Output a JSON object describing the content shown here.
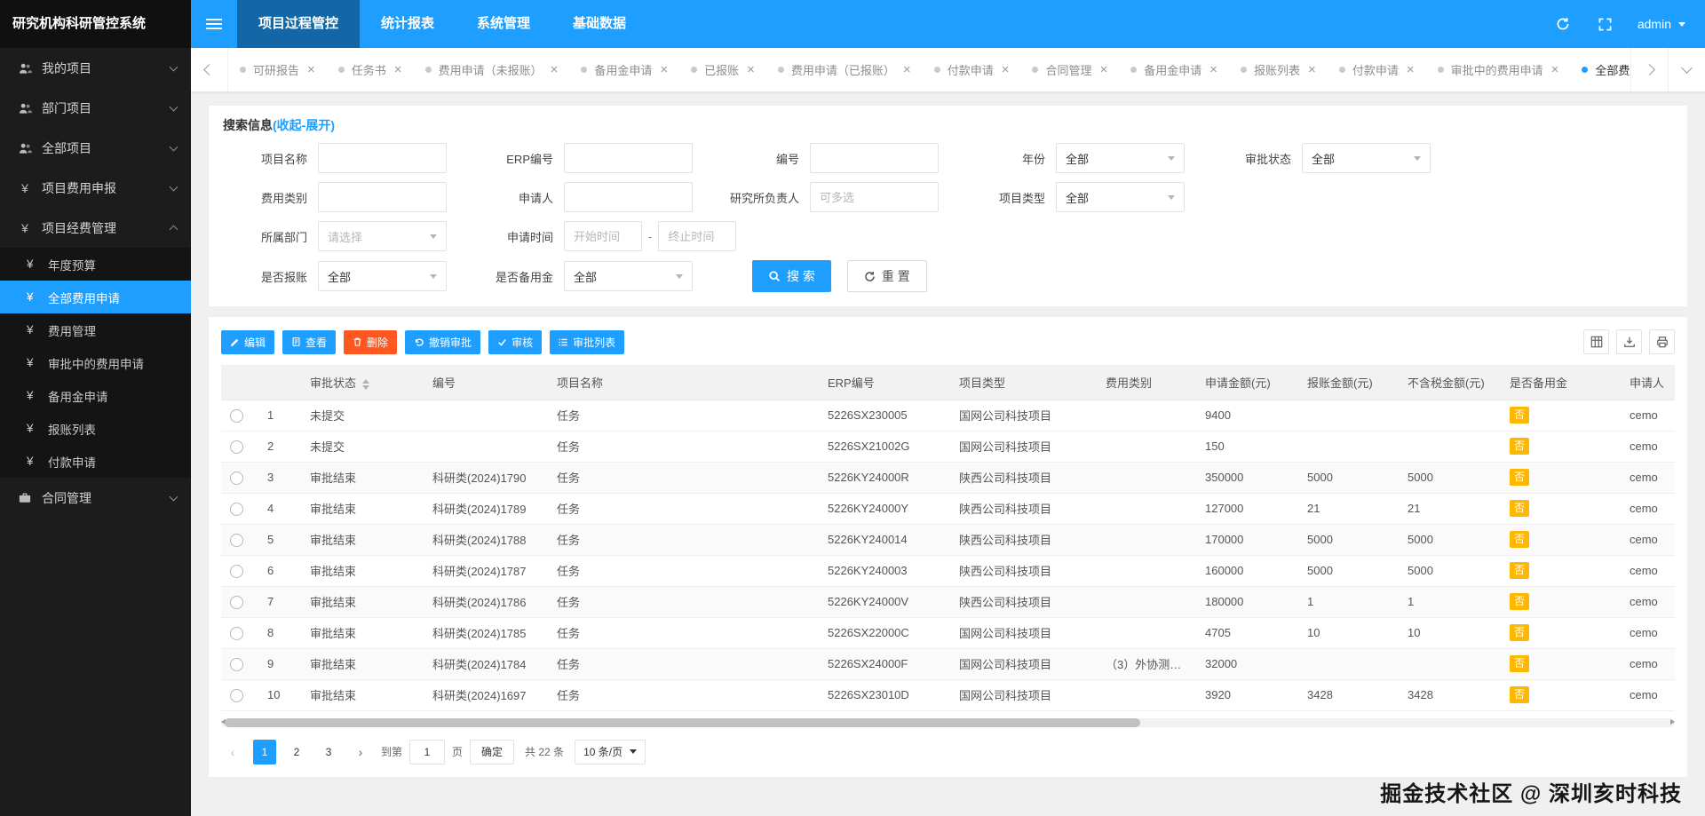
{
  "app": {
    "title": "研究机构科研管控系统",
    "user": "admin",
    "watermark": "掘金技术社区 @ 深圳亥时科技"
  },
  "icons": {
    "close": "×",
    "yen": "¥"
  },
  "topnav": {
    "items": [
      "项目过程管控",
      "统计报表",
      "系统管理",
      "基础数据"
    ]
  },
  "sidebar": {
    "items": [
      "我的项目",
      "部门项目",
      "全部项目",
      "项目费用申报",
      "项目经费管理",
      "合同管理"
    ],
    "submenu": [
      "年度预算",
      "全部费用申请",
      "费用管理",
      "审批中的费用申请",
      "备用金申请",
      "报账列表",
      "付款申请"
    ]
  },
  "tabstrip": {
    "items": [
      "可研报告",
      "任务书",
      "费用申请（未报账）",
      "备用金申请",
      "已报账",
      "费用申请（已报账）",
      "付款申请",
      "合同管理",
      "备用金申请",
      "报账列表",
      "付款申请",
      "审批中的费用申请",
      "全部费用"
    ]
  },
  "search": {
    "title": "搜索信息",
    "toggle": "(收起-展开)",
    "fields": {
      "project_name": {
        "label": "项目名称"
      },
      "erp_no": {
        "label": "ERP编号"
      },
      "no": {
        "label": "编号"
      },
      "year": {
        "label": "年份",
        "value": "全部"
      },
      "approval_status": {
        "label": "审批状态",
        "value": "全部"
      },
      "expense_category": {
        "label": "费用类别"
      },
      "applicant": {
        "label": "申请人"
      },
      "institute_leader": {
        "label": "研究所负责人",
        "placeholder": "可多选"
      },
      "project_type": {
        "label": "项目类型",
        "value": "全部"
      },
      "department": {
        "label": "所属部门",
        "placeholder": "请选择"
      },
      "apply_time": {
        "label": "申请时间",
        "start_placeholder": "开始时间",
        "separator": "-",
        "end_placeholder": "终止时间"
      },
      "is_reimbursed": {
        "label": "是否报账",
        "value": "全部"
      },
      "is_reserve": {
        "label": "是否备用金",
        "value": "全部"
      }
    },
    "buttons": {
      "search": "搜 索",
      "reset": "重 置"
    }
  },
  "toolbar": {
    "buttons": {
      "edit": "编辑",
      "view": "查看",
      "delete": "删除",
      "revoke": "撤销审批",
      "audit": "审核",
      "audit_list": "审批列表"
    }
  },
  "table": {
    "columns": [
      "审批状态",
      "编号",
      "项目名称",
      "ERP编号",
      "项目类型",
      "费用类别",
      "申请金额(元)",
      "报账金额(元)",
      "不含税金额(元)",
      "是否备用金",
      "申请人"
    ],
    "rows": [
      {
        "index": "1",
        "status": "未提交",
        "no": "",
        "name": "任务",
        "erp": "5226SX230005",
        "type": "国网公司科技项目",
        "category": "",
        "amount": "9400",
        "reimbursed": "",
        "tax_free": "",
        "reserve": "否",
        "applicant": "cemo"
      },
      {
        "index": "2",
        "status": "未提交",
        "no": "",
        "name": "任务",
        "erp": "5226SX21002G",
        "type": "国网公司科技项目",
        "category": "",
        "amount": "150",
        "reimbursed": "",
        "tax_free": "",
        "reserve": "否",
        "applicant": "cemo"
      },
      {
        "index": "3",
        "status": "审批结束",
        "no": "科研类(2024)1790",
        "name": "任务",
        "erp": "5226KY24000R",
        "type": "陕西公司科技项目",
        "category": "",
        "amount": "350000",
        "reimbursed": "5000",
        "tax_free": "5000",
        "reserve": "否",
        "applicant": "cemo"
      },
      {
        "index": "4",
        "status": "审批结束",
        "no": "科研类(2024)1789",
        "name": "任务",
        "erp": "5226KY24000Y",
        "type": "陕西公司科技项目",
        "category": "",
        "amount": "127000",
        "reimbursed": "21",
        "tax_free": "21",
        "reserve": "否",
        "applicant": "cemo"
      },
      {
        "index": "5",
        "status": "审批结束",
        "no": "科研类(2024)1788",
        "name": "任务",
        "erp": "5226KY240014",
        "type": "陕西公司科技项目",
        "category": "",
        "amount": "170000",
        "reimbursed": "5000",
        "tax_free": "5000",
        "reserve": "否",
        "applicant": "cemo"
      },
      {
        "index": "6",
        "status": "审批结束",
        "no": "科研类(2024)1787",
        "name": "任务",
        "erp": "5226KY240003",
        "type": "陕西公司科技项目",
        "category": "",
        "amount": "160000",
        "reimbursed": "5000",
        "tax_free": "5000",
        "reserve": "否",
        "applicant": "cemo"
      },
      {
        "index": "7",
        "status": "审批结束",
        "no": "科研类(2024)1786",
        "name": "任务",
        "erp": "5226KY24000V",
        "type": "陕西公司科技项目",
        "category": "",
        "amount": "180000",
        "reimbursed": "1",
        "tax_free": "1",
        "reserve": "否",
        "applicant": "cemo"
      },
      {
        "index": "8",
        "status": "审批结束",
        "no": "科研类(2024)1785",
        "name": "任务",
        "erp": "5226SX22000C",
        "type": "国网公司科技项目",
        "category": "",
        "amount": "4705",
        "reimbursed": "10",
        "tax_free": "10",
        "reserve": "否",
        "applicant": "cemo"
      },
      {
        "index": "9",
        "status": "审批结束",
        "no": "科研类(2024)1784",
        "name": "任务",
        "erp": "5226SX24000F",
        "type": "国网公司科技项目",
        "category": "（3）外协测…",
        "amount": "32000",
        "reimbursed": "",
        "tax_free": "",
        "reserve": "否",
        "applicant": "cemo"
      },
      {
        "index": "10",
        "status": "审批结束",
        "no": "科研类(2024)1697",
        "name": "任务",
        "erp": "5226SX23010D",
        "type": "国网公司科技项目",
        "category": "",
        "amount": "3920",
        "reimbursed": "3428",
        "tax_free": "3428",
        "reserve": "否",
        "applicant": "cemo"
      }
    ]
  },
  "pagination": {
    "pages": [
      "1",
      "2",
      "3"
    ],
    "goto_prefix": "到第",
    "goto_value": "1",
    "goto_unit": "页",
    "confirm": "确定",
    "total": "共 22 条",
    "page_size": "10 条/页"
  },
  "colors": {
    "accent": "#1E9FFF",
    "danger": "#FF5722",
    "badge": "#FFB800"
  }
}
